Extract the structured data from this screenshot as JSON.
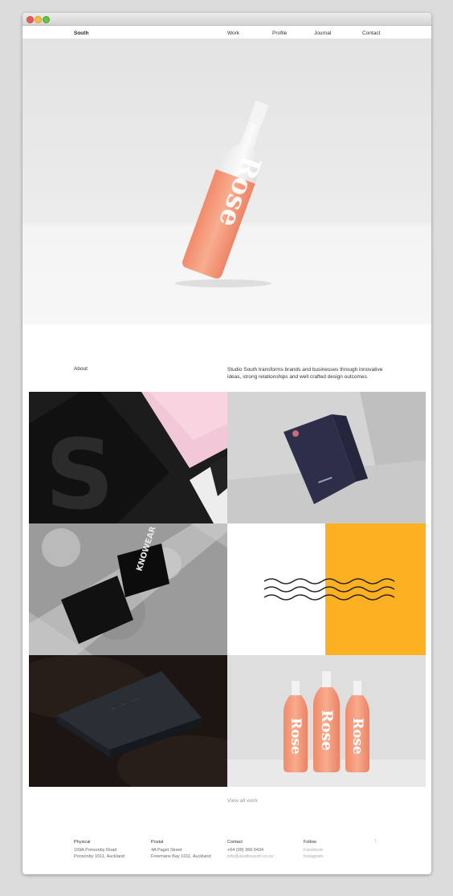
{
  "nav": {
    "brand": "South",
    "links": [
      "Work",
      "Profile",
      "Journal",
      "Contact"
    ]
  },
  "hero": {
    "bottle_label": "Rose",
    "bottle_color": "#f39a7c"
  },
  "about": {
    "label": "About",
    "text": "Studio South transforms brands and businesses through innovative ideas, strong relationships and well crafted design outcomes."
  },
  "portfolio": {
    "tiles": [
      {
        "name": "black-stationery-with-s"
      },
      {
        "name": "navy-folder"
      },
      {
        "name": "knowear-business-cards"
      },
      {
        "name": "wave-lines-yellow"
      },
      {
        "name": "embossed-black-box"
      },
      {
        "name": "three-rose-bottles"
      }
    ],
    "card_text": "KNOWEAR",
    "bottle_label": "Rose",
    "accent_yellow": "#fdb022"
  },
  "view_all": "View all work",
  "footer": {
    "physical": {
      "heading": "Physical",
      "lines": [
        "109A Ponsonby Road",
        "Ponsonby 1011, Auckland"
      ]
    },
    "postal": {
      "heading": "Postal",
      "lines": [
        "4A Paget Street",
        "Freemans Bay 1011, Auckland"
      ]
    },
    "contact": {
      "heading": "Contact",
      "lines": [
        "+64 (09) 360 6434",
        "info@studiosouth.co.nz"
      ]
    },
    "follow": {
      "heading": "Follow",
      "lines": [
        "Facebook",
        "Instagram"
      ]
    },
    "up_icon": "arrow-up-icon"
  }
}
